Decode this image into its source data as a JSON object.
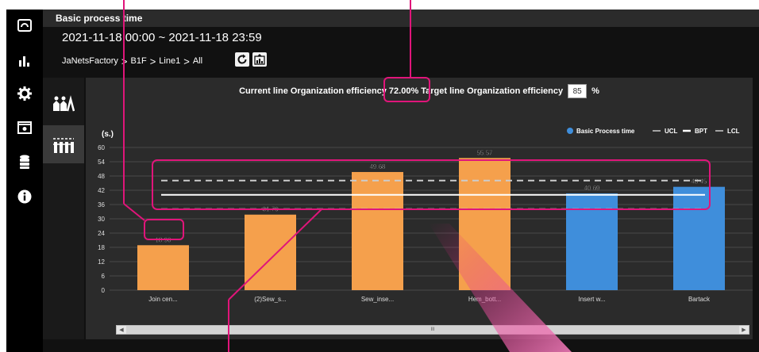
{
  "header": {
    "title": "Basic process time",
    "date_range": "2021-11-18 00:00 ~ 2021-11-18 23:59",
    "breadcrumb": [
      "JaNetsFactory",
      "B1F",
      "Line1",
      "All"
    ],
    "breadcrumb_sep": ">"
  },
  "efficiency": {
    "current_label": "Current line Organization efficiency",
    "current_value": "72.00%",
    "target_label": "Target line Organization efficiency",
    "target_value": "85",
    "target_unit": "%"
  },
  "scrollbar": {
    "thumb_label": "III"
  },
  "colors": {
    "bar_orange": "#F5A04C",
    "bar_blue": "#3F8EDB",
    "annotation": "#E0157A",
    "accent_light": "#FFFFFF"
  },
  "chart_data": {
    "type": "bar",
    "ylabel": "(s.)",
    "ylim": [
      0,
      60
    ],
    "yticks": [
      0,
      6,
      12,
      18,
      24,
      30,
      36,
      42,
      48,
      54,
      60
    ],
    "categories": [
      "Join cen...",
      "(2)Sew_s...",
      "Sew_inse...",
      "Hem_bott...",
      "Insert w...",
      "Bartack"
    ],
    "values": [
      18.9,
      31.76,
      49.68,
      55.57,
      40.69,
      43.45
    ],
    "value_labels": [
      "18.90",
      "31.76",
      "49.68",
      "55.57",
      "40.69",
      "43.45"
    ],
    "bar_colors": [
      "#F5A04C",
      "#F5A04C",
      "#F5A04C",
      "#F5A04C",
      "#3F8EDB",
      "#3F8EDB"
    ],
    "legend": [
      "Basic Process time",
      "UCL",
      "BPT",
      "LCL"
    ],
    "legend_position": "top-right",
    "ucl": 46.1,
    "bpt": 40.1,
    "lcl": 34.1,
    "grid": true
  }
}
